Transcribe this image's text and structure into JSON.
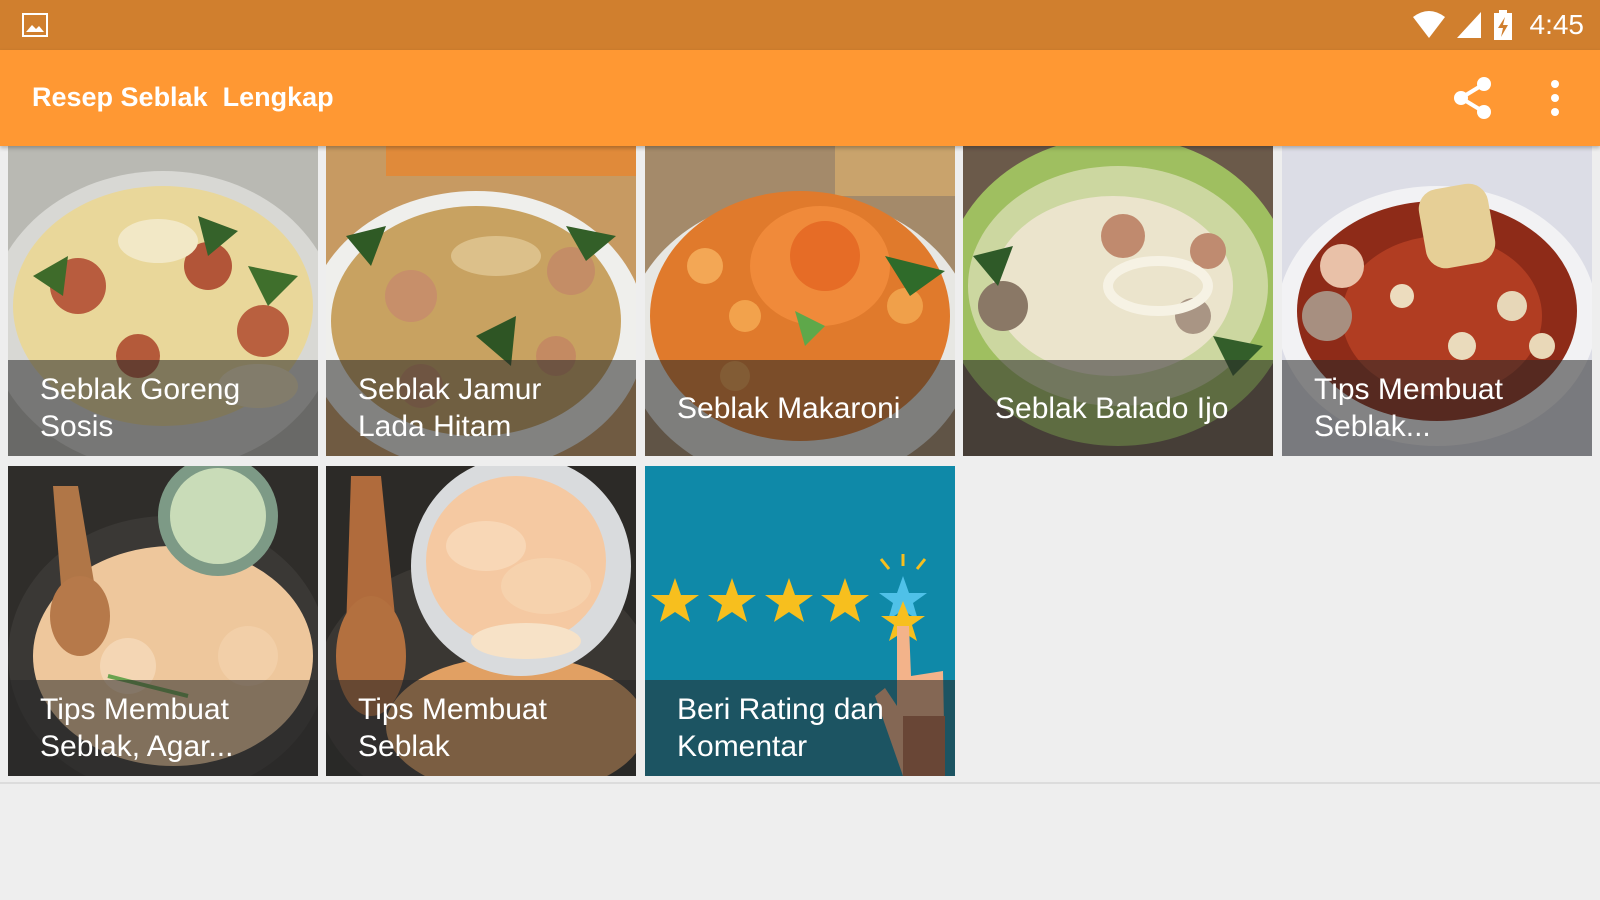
{
  "status_bar": {
    "time": "4:45",
    "icons": [
      "image-notification-icon",
      "wifi-icon",
      "signal-icon",
      "battery-charging-icon"
    ]
  },
  "app_bar": {
    "title": "Resep Seblak  Lengkap",
    "actions": [
      "share-icon",
      "more-vert-icon"
    ]
  },
  "tiles": [
    {
      "label": "Seblak Goreng\nSosis"
    },
    {
      "label": "Seblak Jamur\nLada Hitam"
    },
    {
      "label": "Seblak Makaroni"
    },
    {
      "label": "Seblak Balado Ijo"
    },
    {
      "label": "Tips Membuat\nSeblak..."
    },
    {
      "label": "Tips Membuat\nSeblak, Agar..."
    },
    {
      "label": "Tips Membuat\nSeblak"
    },
    {
      "label": "Beri Rating dan\nKomentar"
    }
  ],
  "colors": {
    "status_bar": "#d07f2e",
    "app_bar": "#ff9833",
    "background": "#eeeeee",
    "rating_tile": "#0f89a8",
    "star": "#f7bf1e"
  }
}
